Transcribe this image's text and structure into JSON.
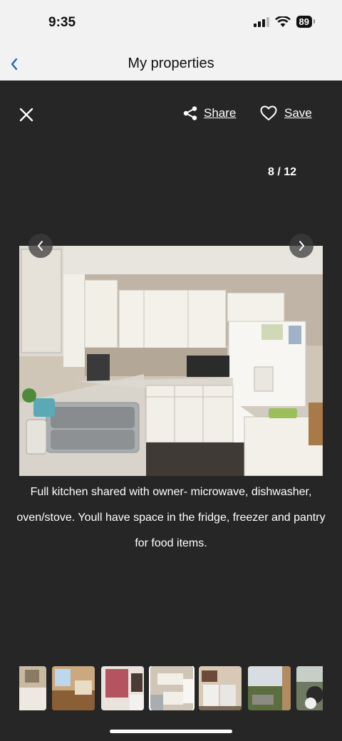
{
  "status_bar": {
    "time": "9:35",
    "battery": "89"
  },
  "nav": {
    "title": "My properties"
  },
  "viewer": {
    "share_label": "Share",
    "save_label": "Save",
    "counter": "8 / 12",
    "caption": "Full kitchen shared with owner- microwave, dishwasher, oven/stove. Youll have space in the fridge, freezer and pantry for food items."
  },
  "thumbnails": [
    {
      "active": false
    },
    {
      "active": false
    },
    {
      "active": false
    },
    {
      "active": true
    },
    {
      "active": false
    },
    {
      "active": false
    },
    {
      "active": false
    }
  ]
}
